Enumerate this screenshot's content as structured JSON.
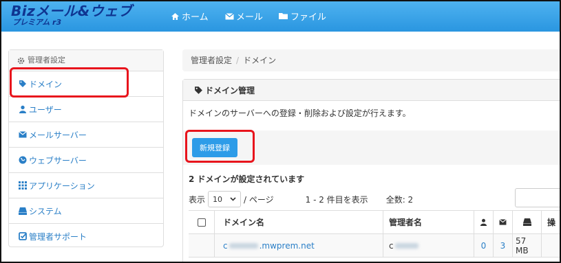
{
  "header": {
    "logo_main": "Bizメール&ウェブ",
    "logo_sub": "プレミアム r3",
    "nav": [
      {
        "label": "ホーム",
        "icon": "home-icon"
      },
      {
        "label": "メール",
        "icon": "envelope-icon"
      },
      {
        "label": "ファイル",
        "icon": "folder-icon"
      }
    ]
  },
  "sidebar": {
    "heading": "管理者設定",
    "items": [
      {
        "label": "ドメイン",
        "icon": "tag-icon"
      },
      {
        "label": "ユーザー",
        "icon": "user-icon"
      },
      {
        "label": "メールサーバー",
        "icon": "envelope-icon"
      },
      {
        "label": "ウェブサーバー",
        "icon": "globe-icon"
      },
      {
        "label": "アプリケーション",
        "icon": "grid-icon"
      },
      {
        "label": "システム",
        "icon": "drive-icon"
      },
      {
        "label": "管理者サポート",
        "icon": "check-square-icon"
      }
    ]
  },
  "breadcrumb": {
    "root": "管理者設定",
    "separator": "/",
    "current": "ドメイン"
  },
  "panel": {
    "title": "ドメイン管理",
    "description": "ドメインのサーバーへの登録・削除および設定が行えます。",
    "new_button": "新規登録",
    "count_text": "2 ドメインが設定されています",
    "pager": {
      "show_label": "表示",
      "per_page_value": "10",
      "per_page_label": "/ ページ",
      "range_text": "1 - 2 件目を表示",
      "total_text": "全数: 2"
    }
  },
  "table": {
    "headers": {
      "domain": "ドメイン名",
      "admin": "管理者名",
      "users_icon": "user-icon",
      "mail_icon": "envelope-icon",
      "disk_icon": "drive-icon",
      "ops": "操"
    },
    "rows": [
      {
        "domain_prefix": "c",
        "domain_suffix": ".mwprem.net",
        "admin": "c",
        "users": "0",
        "mail": "3",
        "disk": "57 MB"
      }
    ]
  },
  "colors": {
    "header_bg": "#2a96e0",
    "link": "#2a7fc7",
    "highlight": "#e8141c",
    "button": "#2d9ce8"
  }
}
